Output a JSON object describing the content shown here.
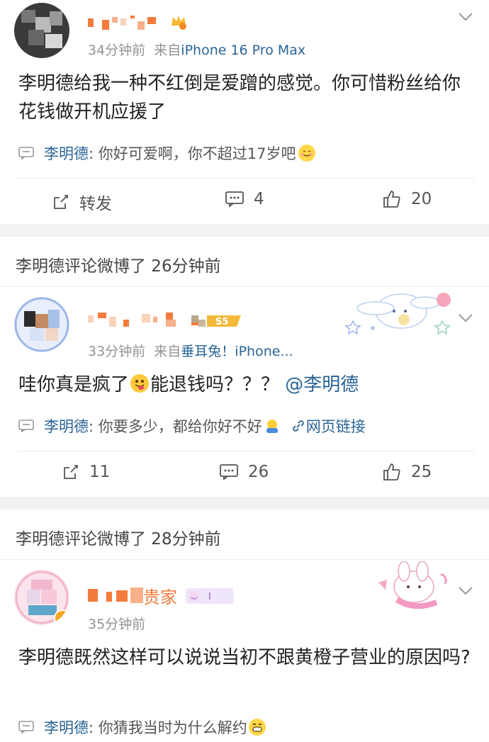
{
  "post1": {
    "time": "34分钟前",
    "from_prefix": "来自",
    "source": "iPhone 16 Pro Max",
    "text": "李明德给我一种不红倒是爱蹭的感觉。你可惜粉丝给你花钱做开机应援了",
    "reply_name": "李明德",
    "reply_text": ": 你好可爱啊，你不超过17岁吧",
    "reply_emoji": "smile-emoji",
    "repost_label": "转发",
    "comment_count": "4",
    "like_count": "20"
  },
  "section1": {
    "title": "李明德评论微博了 26分钟前"
  },
  "post2": {
    "time": "33分钟前",
    "from_prefix": "来自",
    "source": "垂耳兔！iPhone...",
    "text_a": "哇你真是疯了",
    "text_b": "能退钱吗？？？",
    "mention": "@李明德",
    "reply_name": "李明德",
    "reply_text": ": 你要多少，都给你好不好",
    "reply_link": "网页链接",
    "repost_count": "11",
    "comment_count": "26",
    "like_count": "25",
    "badge": "S5"
  },
  "section2": {
    "title": "李明德评论微博了 28分钟前"
  },
  "post3": {
    "name_suffix": "贵家",
    "time": "35分钟前",
    "text": "李明德既然这样可以说说当初不跟黄橙子营业的原因吗?",
    "reply_name": "李明德",
    "reply_text": ": 你猜我当时为什么解约"
  },
  "colors": {
    "link_blue": "#2a6496",
    "meta_gray": "#939393",
    "separator": "#f2f2f2",
    "censor_orange": "#f47b3b"
  }
}
